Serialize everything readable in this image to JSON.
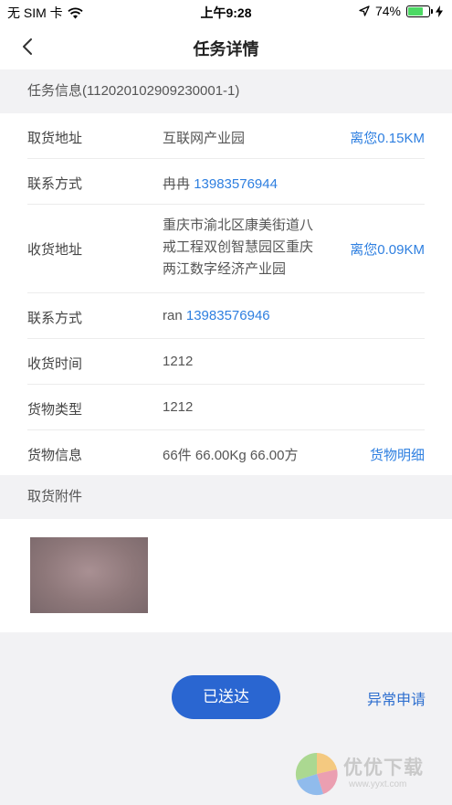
{
  "status_bar": {
    "carrier": "无 SIM 卡",
    "time": "上午9:28",
    "battery": "74%",
    "battery_level": 0.74,
    "icons": [
      "wifi-icon",
      "location-arrow-icon",
      "battery-icon",
      "charging-icon"
    ]
  },
  "nav": {
    "title": "任务详情",
    "back_icon": "chevron-left-icon"
  },
  "task_info": {
    "header": "任务信息(112020102909230001-1)",
    "rows": [
      {
        "label": "取货地址",
        "value": "互联网产业园",
        "action": "离您0.15KM"
      },
      {
        "label": "联系方式",
        "name": "冉冉",
        "phone": "13983576944"
      },
      {
        "label": "收货地址",
        "value_lines": [
          "重庆市渝北区康美街道八",
          "戒工程双创智慧园区重庆",
          "两江数字经济产业园"
        ],
        "action": "离您0.09KM"
      },
      {
        "label": "联系方式",
        "name": "ran",
        "phone": "13983576946"
      },
      {
        "label": "收货时间",
        "value": "1212"
      },
      {
        "label": "货物类型",
        "value": "1212"
      },
      {
        "label": "货物信息",
        "value": "66件 66.00Kg 66.00方",
        "action": "货物明细"
      }
    ]
  },
  "attachments": {
    "header": "取货附件"
  },
  "footer": {
    "primary_button": "已送达",
    "secondary_link": "异常申请"
  },
  "watermark": {
    "text": "优优下载",
    "url": "www.yyxt.com"
  },
  "colors": {
    "accent": "#2e7fe0",
    "primary_button": "#2a66d1",
    "background": "#f2f2f4",
    "battery": "#4cd964"
  }
}
